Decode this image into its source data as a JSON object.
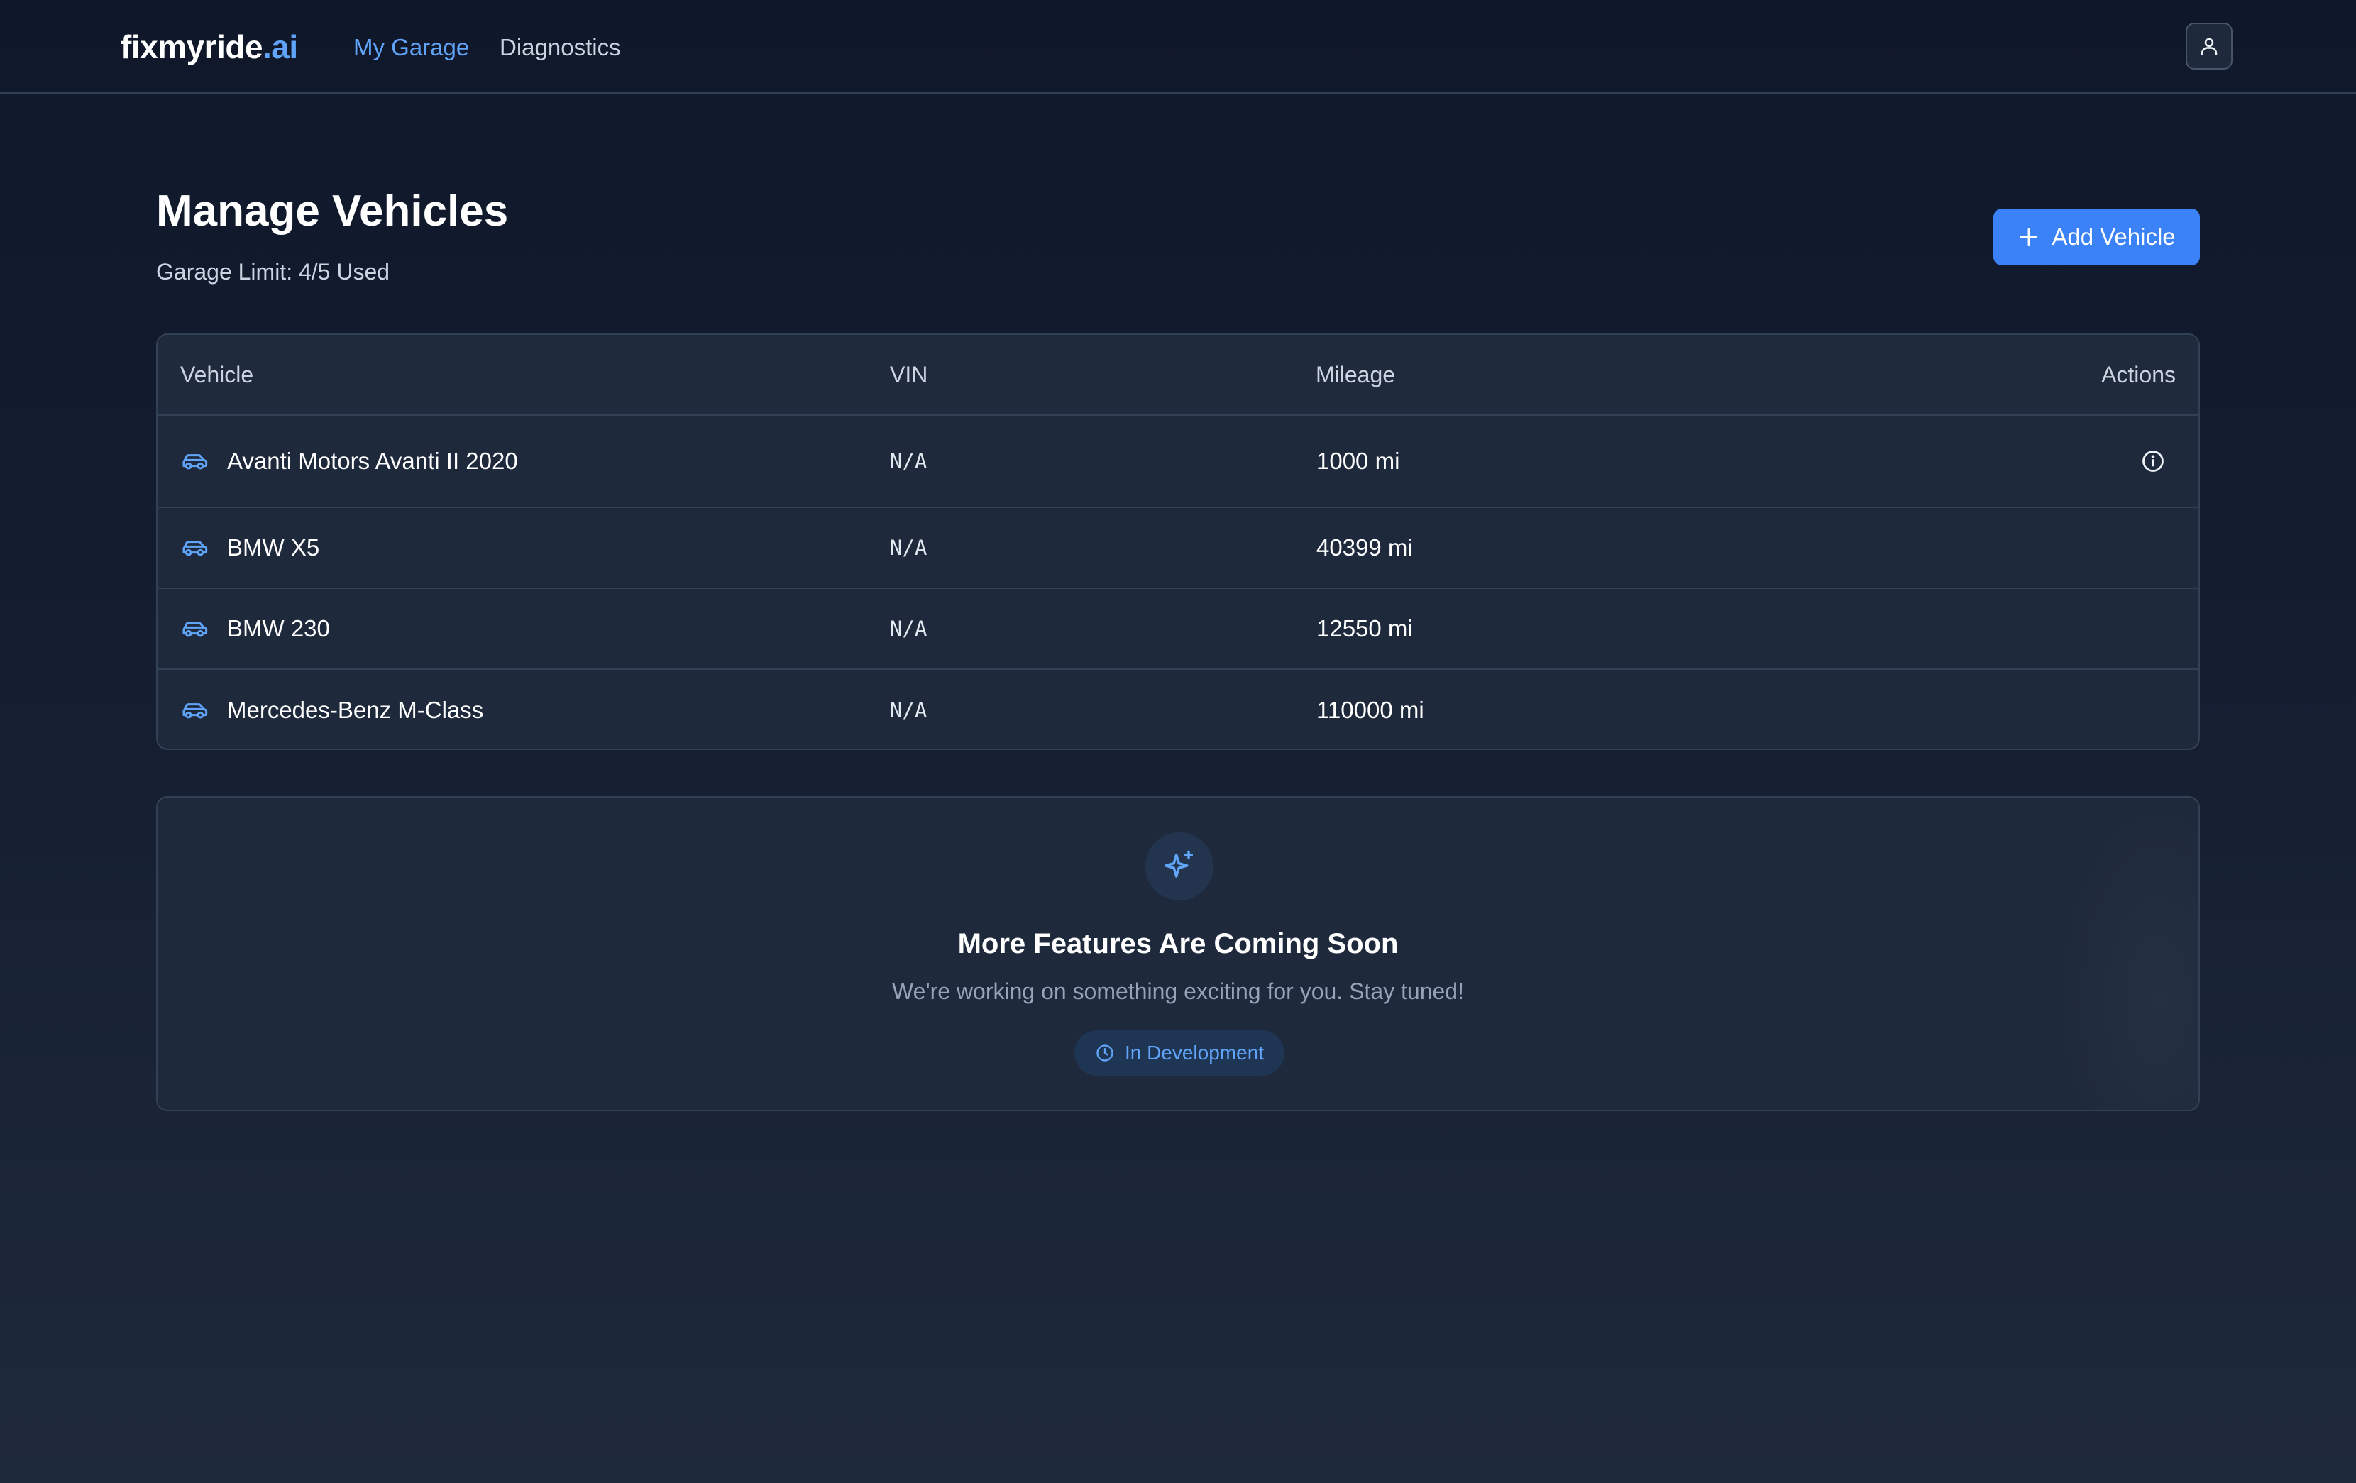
{
  "nav": {
    "brand_main": "fixmyride",
    "brand_accent": ".ai",
    "links": [
      {
        "label": "My Garage",
        "active": true
      },
      {
        "label": "Diagnostics",
        "active": false
      }
    ],
    "user_icon": "user-icon"
  },
  "header": {
    "title": "Manage Vehicles",
    "garage_limit": "Garage Limit: 4/5 Used",
    "add_button_label": "Add Vehicle",
    "add_button_icon": "plus-icon"
  },
  "table": {
    "columns": {
      "vehicle": "Vehicle",
      "vin": "VIN",
      "mileage": "Mileage",
      "actions": "Actions"
    },
    "rows": [
      {
        "name": "Avanti Motors Avanti II 2020",
        "vin": "N/A",
        "mileage": "1000 mi",
        "icon": "car-icon",
        "action_icon": "info-icon"
      },
      {
        "name": "BMW X5",
        "vin": "N/A",
        "mileage": "40399 mi",
        "icon": "car-icon"
      },
      {
        "name": "BMW 230",
        "vin": "N/A",
        "mileage": "12550 mi",
        "icon": "car-icon"
      },
      {
        "name": "Mercedes-Benz M-Class",
        "vin": "N/A",
        "mileage": "110000 mi",
        "icon": "car-icon"
      }
    ]
  },
  "coming_soon": {
    "icon": "sparkles-icon",
    "title": "More Features Are Coming Soon",
    "subtitle": "We're working on something exciting for you. Stay tuned!",
    "badge": "In Development",
    "badge_icon": "clock-icon"
  },
  "colors": {
    "accent": "#3b82f6",
    "accent_text": "#60a5fa",
    "background_top": "#0f172a",
    "card": "#1e293b",
    "border": "#334155"
  }
}
